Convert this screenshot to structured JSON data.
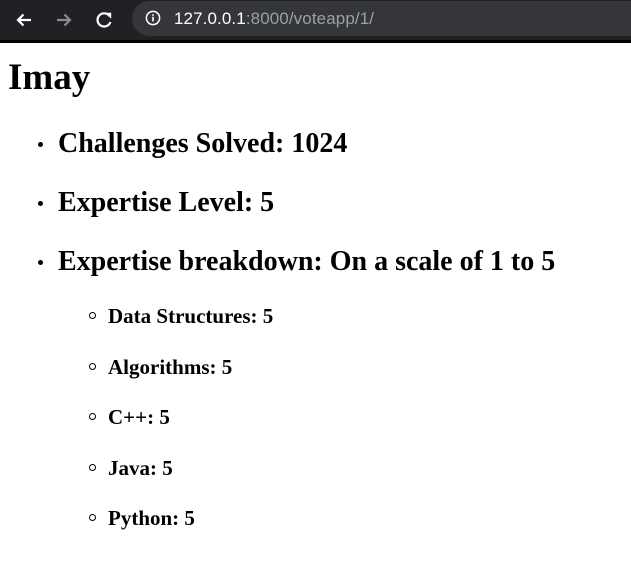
{
  "browser": {
    "url_host": "127.0.0.1",
    "url_rest": ":8000/voteapp/1/"
  },
  "page": {
    "title": "Imay",
    "items": [
      {
        "label": "Challenges Solved: 1024"
      },
      {
        "label": "Expertise Level: 5"
      },
      {
        "label": "Expertise breakdown: On a scale of 1 to 5"
      }
    ],
    "breakdown": [
      {
        "label": "Data Structures: 5"
      },
      {
        "label": "Algorithms: 5"
      },
      {
        "label": "C++: 5"
      },
      {
        "label": "Java: 5"
      },
      {
        "label": "Python: 5"
      }
    ]
  },
  "icons": {
    "back": "back-arrow-icon",
    "forward": "forward-arrow-icon",
    "reload": "reload-icon",
    "info": "info-icon"
  },
  "colors": {
    "toolbar": "#202124",
    "omnibox": "#35363a",
    "url_host": "#ffffff",
    "url_rest": "#9aa0a6",
    "forward_disabled": "#8a8b8e"
  }
}
